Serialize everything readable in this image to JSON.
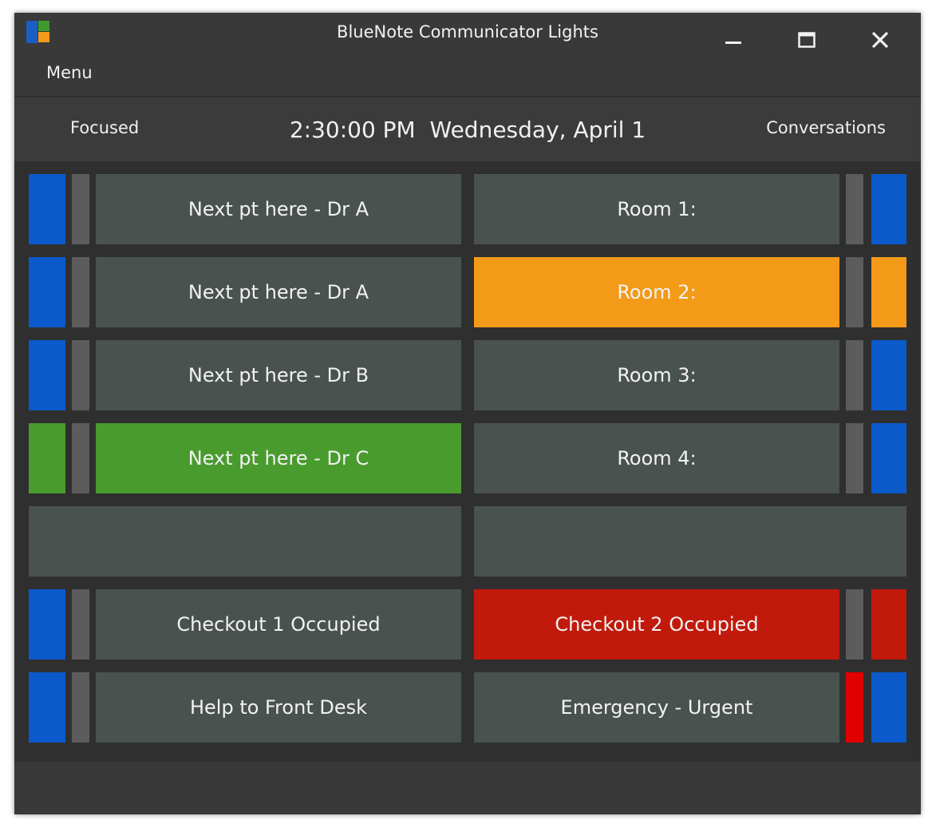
{
  "window": {
    "title": "BlueNote Communicator Lights",
    "menu_label": "Menu"
  },
  "header": {
    "left_label": "Focused",
    "time": "2:30:00 PM",
    "date": "Wednesday, April 1",
    "right_label": "Conversations"
  },
  "colors": {
    "cell_default": "#4a5250",
    "blue": "#0b5acb",
    "gray": "#5c5c5c",
    "orange": "#f39a18",
    "green": "#499b2e",
    "red": "#c11a0c",
    "bright_red": "#e00000"
  },
  "rows": [
    {
      "left": {
        "label": "Next pt here - Dr A",
        "color": "#4a5250",
        "outer": "#0b5acb",
        "inner": "#5c5c5c"
      },
      "right": {
        "label": "Room 1:",
        "color": "#4a5250",
        "outer": "#0b5acb",
        "inner": "#5c5c5c"
      }
    },
    {
      "left": {
        "label": "Next pt here - Dr A",
        "color": "#4a5250",
        "outer": "#0b5acb",
        "inner": "#5c5c5c"
      },
      "right": {
        "label": "Room 2:",
        "color": "#f39a18",
        "outer": "#f39a18",
        "inner": "#5c5c5c"
      }
    },
    {
      "left": {
        "label": "Next pt here - Dr B",
        "color": "#4a5250",
        "outer": "#0b5acb",
        "inner": "#5c5c5c"
      },
      "right": {
        "label": "Room 3:",
        "color": "#4a5250",
        "outer": "#0b5acb",
        "inner": "#5c5c5c"
      }
    },
    {
      "left": {
        "label": "Next pt here - Dr C",
        "color": "#499b2e",
        "outer": "#499b2e",
        "inner": "#5c5c5c"
      },
      "right": {
        "label": "Room 4:",
        "color": "#4a5250",
        "outer": "#0b5acb",
        "inner": "#5c5c5c"
      }
    },
    {
      "left": {
        "label": "",
        "color": "#4a5250",
        "outer": null,
        "inner": null
      },
      "right": {
        "label": "",
        "color": "#4a5250",
        "outer": null,
        "inner": null
      }
    },
    {
      "left": {
        "label": "Checkout 1 Occupied",
        "color": "#4a5250",
        "outer": "#0b5acb",
        "inner": "#5c5c5c"
      },
      "right": {
        "label": "Checkout 2 Occupied",
        "color": "#c11a0c",
        "outer": "#c11a0c",
        "inner": "#5c5c5c"
      }
    },
    {
      "left": {
        "label": "Help to Front Desk",
        "color": "#4a5250",
        "outer": "#0b5acb",
        "inner": "#5c5c5c"
      },
      "right": {
        "label": "Emergency - Urgent",
        "color": "#4a5250",
        "outer": "#0b5acb",
        "inner": "#e00000"
      }
    }
  ]
}
